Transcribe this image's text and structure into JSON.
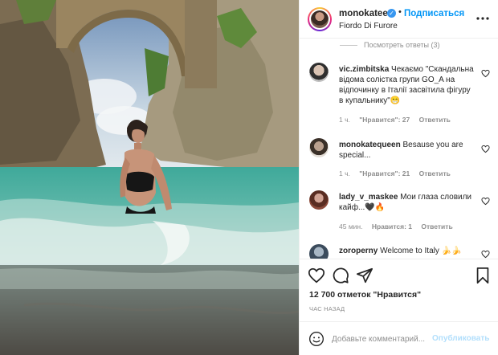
{
  "post": {
    "username": "monokatee",
    "follow_label": "Подписаться",
    "separator": "•",
    "location": "Fiordo Di Furore",
    "more_icon": "more-options-icon"
  },
  "comments": {
    "view_replies": "Посмотреть ответы (3)",
    "items": [
      {
        "user": "vic.zimbitska",
        "text": "Чекаємо \"Скандальна відома солістка групи GO_A на відпочинку в Італії засвітила фігуру в купальнику\"😁",
        "time": "1 ч.",
        "likes": "\"Нравится\": 27",
        "reply": "Ответить"
      },
      {
        "user": "monokatequeen",
        "text": "Besause you are special...",
        "time": "1 ч.",
        "likes": "\"Нравится\": 21",
        "reply": "Ответить"
      },
      {
        "user": "lady_v_maskee",
        "text": "Мои глаза словили кайф...🖤🔥",
        "time": "45 мин.",
        "likes": "Нравится: 1",
        "reply": "Ответить"
      },
      {
        "user": "zoroperny",
        "text": "Welcome to Italy 🍌🍌"
      }
    ]
  },
  "stats": {
    "likes": "12 700 отметок \"Нравится\"",
    "time_ago": "ЧАС НАЗАД"
  },
  "composer": {
    "placeholder": "Добавьте комментарий...",
    "publish_label": "Опубликовать"
  },
  "colors": {
    "accent": "#0095f6",
    "verified": "#3897f0",
    "muted": "#8e8e8e",
    "publish_disabled": "#b2dffc"
  }
}
